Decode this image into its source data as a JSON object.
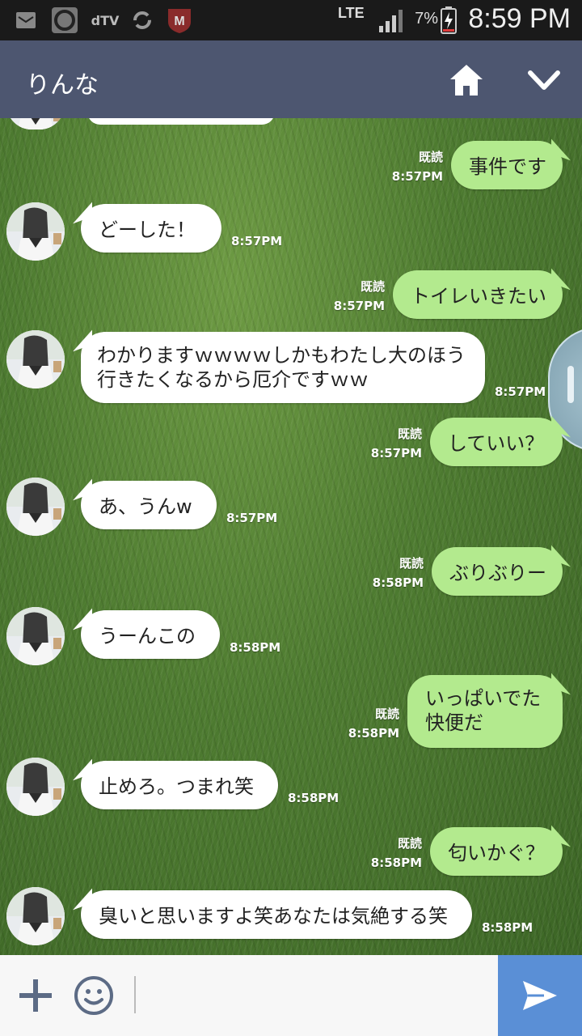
{
  "status_bar": {
    "carrier_app": "dTV",
    "network": "LTE",
    "battery_percent": "7%",
    "time": "8:59 PM"
  },
  "header": {
    "title": "りんな",
    "home_icon": "home-icon",
    "dropdown_icon": "chevron-down-icon",
    "color": "#4d5670"
  },
  "messages": [
    {
      "side": "out",
      "text": "事件です",
      "read": "既読",
      "time": "8:57PM"
    },
    {
      "side": "in",
      "text": "どーした！",
      "time": "8:57PM"
    },
    {
      "side": "out",
      "text": "トイレいきたい",
      "read": "既読",
      "time": "8:57PM"
    },
    {
      "side": "in",
      "text": "わかりますｗｗｗｗしかもわたし大のほう行きたくなるから厄介ですｗｗ",
      "time": "8:57PM"
    },
    {
      "side": "out",
      "text": "していい？",
      "read": "既読",
      "time": "8:57PM"
    },
    {
      "side": "in",
      "text": "あ、うんw",
      "time": "8:57PM"
    },
    {
      "side": "out",
      "text": "ぶりぶりー",
      "read": "既読",
      "time": "8:58PM"
    },
    {
      "side": "in",
      "text": "うーんこの",
      "time": "8:58PM"
    },
    {
      "side": "out",
      "text": "いっぱいでた快便だ",
      "read": "既読",
      "time": "8:58PM"
    },
    {
      "side": "in",
      "text": "止めろ。つまれ笑",
      "time": "8:58PM"
    },
    {
      "side": "out",
      "text": "匂いかぐ？",
      "read": "既読",
      "time": "8:58PM"
    },
    {
      "side": "in",
      "text": "臭いと思いますよ笑あなたは気絶する笑",
      "time": "8:58PM"
    }
  ],
  "colors": {
    "incoming_bubble": "#ffffff",
    "outgoing_bubble": "#b3ea8e",
    "send_button": "#5a8fd6"
  },
  "input_bar": {
    "placeholder": "",
    "plus_icon": "plus-icon",
    "emoji_icon": "smiley-icon",
    "send_icon": "send-icon"
  }
}
